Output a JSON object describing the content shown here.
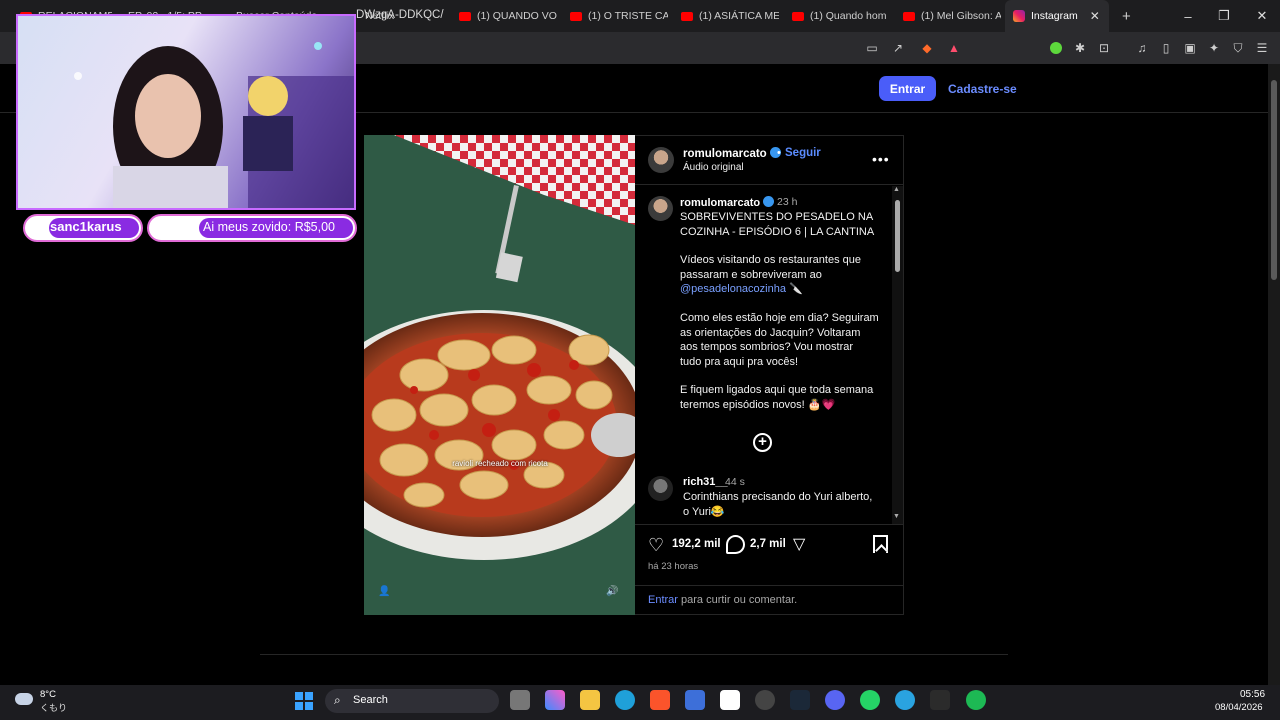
{
  "browser": {
    "tabs": [
      {
        "title": "RELACIONAME..."
      },
      {
        "title": "EP. 02 - 1/5: PP..."
      },
      {
        "title": "Buscar Conteúdo"
      },
      {
        "title": "Netflix"
      },
      {
        "title": "(1) QUANDO VO"
      },
      {
        "title": "(1) O TRISTE CAS"
      },
      {
        "title": "(1) ASIÁTICA ME"
      },
      {
        "title": "(1) Quando hom"
      },
      {
        "title": "(1) Mel Gibson: A"
      },
      {
        "title": "Instagram"
      }
    ],
    "new_tab": "+",
    "url": "DWzgA-DDKQC/"
  },
  "nav": {
    "login_label": "Entrar",
    "signup_label": "Cadastre-se"
  },
  "post": {
    "username": "romulomarcato",
    "separator": "•",
    "follow_label": "Seguir",
    "audio_label": "Áudio original",
    "media_caption": "ravioli recheado com ricota",
    "caption": {
      "username": "romulomarcato",
      "time": "23 h",
      "title_line1": "SOBREVIVENTES DO PESADELO NA",
      "title_line2": "COZINHA - EPISÓDIO 6 | LA CANTINA",
      "para1_line1": "Vídeos visitando os restaurantes que",
      "para1_line2": "passaram e sobreviveram ao",
      "para1_mention": "@pesadelonacozinha",
      "para1_emoji": "🔪",
      "para2_line1": "Como eles estão hoje em dia? Seguiram",
      "para2_line2": "as orientações do Jacquin? Voltaram",
      "para2_line3": "aos tempos sombrios? Vou mostrar",
      "para2_line4": "tudo pra aqui pra vocês!",
      "para3_line1": "E fiquem ligados aqui que toda semana",
      "para3_line2": "teremos episódios novos! 🎂💗"
    },
    "comments": [
      {
        "username": "rich31__",
        "time": "44 s",
        "text_line1": "Corinthians precisando do Yuri alberto,",
        "text_line2": "o Yuri😂"
      }
    ],
    "likes": "192,2 mil",
    "comments_count": "2,7 mil",
    "posted": "há 23 horas",
    "login_prompt_link": "Entrar",
    "login_prompt_text": " para curtir ou comentar."
  },
  "overlay": {
    "chip1": "sanc1karus",
    "chip2": "Ai meus zovido: R$5,00"
  },
  "taskbar": {
    "weather_temp": "8°C",
    "weather_desc": "くもり",
    "search_label": "Search",
    "time": "05:56",
    "date": "08/04/2026"
  },
  "colors": {
    "accent_button": "#4a5df9",
    "link": "#6b8cff",
    "verified": "#3897f0"
  }
}
